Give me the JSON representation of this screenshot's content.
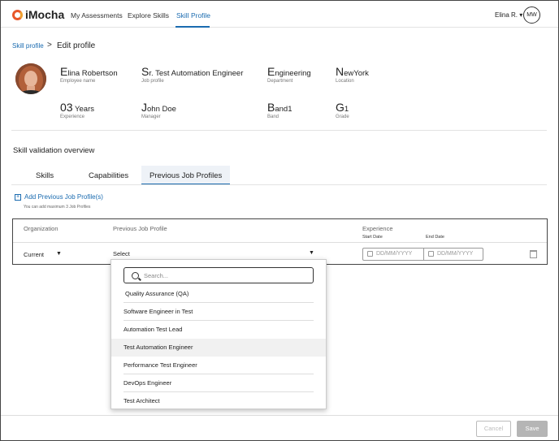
{
  "header": {
    "brand": "iMocha",
    "nav": [
      "My Assessments",
      "Explore Skills",
      "Skill Profile"
    ],
    "active_nav": "Skill Profile",
    "user_name": "Elina R. ▾",
    "user_initials": "MW"
  },
  "breadcrumb": {
    "parent": "Skill profile",
    "separator": ">",
    "current": "Edit profile"
  },
  "profile": {
    "fields": [
      {
        "cap": "E",
        "rest": "lina Robertson",
        "label": "Employee name"
      },
      {
        "cap": "S",
        "rest": "r. Test Automation Engineer",
        "label": "Job profile"
      },
      {
        "cap": "E",
        "rest": "ngineering",
        "label": "Department"
      },
      {
        "cap": "N",
        "rest": "ewYork",
        "label": "Location"
      },
      {
        "cap": "03",
        "rest": " Years",
        "label": "Experience"
      },
      {
        "cap": "J",
        "rest": "ohn Doe",
        "label": "Manager"
      },
      {
        "cap": "B",
        "rest": "and1",
        "label": "Band"
      },
      {
        "cap": "G",
        "rest": "1",
        "label": "Grade"
      }
    ]
  },
  "section_title": "Skill validation overview",
  "tabs": [
    "Skills",
    "Capabilities",
    "Previous Job Profiles"
  ],
  "active_tab": "Previous Job Profiles",
  "add_link": "Add Previous Job Profile(s)",
  "add_hint": "You can add maximum 3 Job Profiles",
  "table": {
    "headers": {
      "organization": "Organization",
      "job_profile": "Previous Job Profile",
      "experience": "Experience",
      "start_date": "Start Date",
      "end_date": "End Date"
    },
    "row": {
      "organization": "Current",
      "job_profile": "Select",
      "start_placeholder": "DD/MM/YYYY",
      "end_placeholder": "DD/MM/YYYY"
    }
  },
  "dropdown": {
    "search_placeholder": "Search...",
    "options": [
      "Quality Assurance (QA)",
      "Software Engineer in Test",
      "Automation Test Lead",
      "Test Automation Engineer",
      "Performance Test Engineer",
      "DevOps Engineer",
      "Test Architect"
    ],
    "highlighted": "Test Automation Engineer"
  },
  "footer": {
    "cancel_label": "Cancel",
    "save_label": "Save"
  },
  "colors": {
    "accent": "#1a6bb0",
    "brand": "#e8572a",
    "disabled_button": "#b5b5b5"
  }
}
